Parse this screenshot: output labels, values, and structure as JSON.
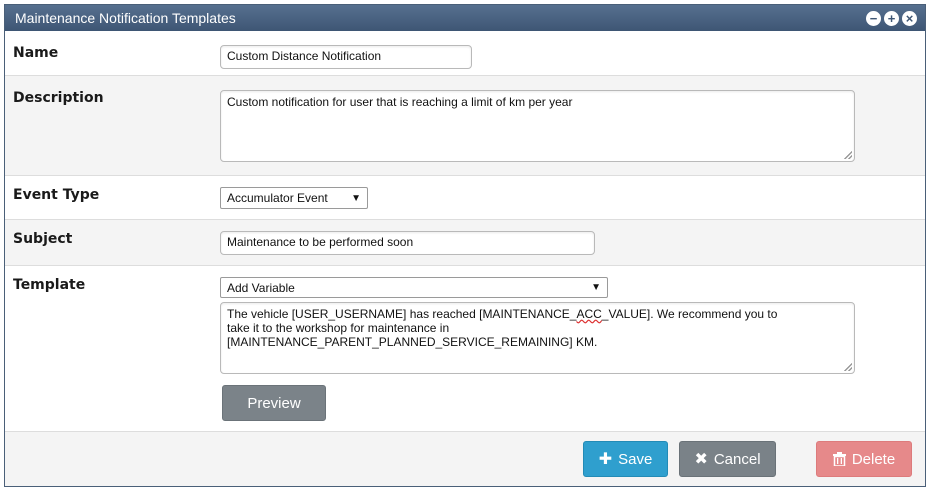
{
  "window": {
    "title": "Maintenance Notification Templates",
    "controls": {
      "minimize": "−",
      "maximize": "+",
      "close": "×"
    }
  },
  "form": {
    "name": {
      "label": "Name",
      "value": "Custom Distance Notification"
    },
    "description": {
      "label": "Description",
      "value": "Custom notification for user that is reaching a limit of km per year"
    },
    "event_type": {
      "label": "Event Type",
      "value": "Accumulator Event"
    },
    "subject": {
      "label": "Subject",
      "value": "Maintenance to be performed soon"
    },
    "template": {
      "label": "Template",
      "variable_select": "Add Variable",
      "body_line1_a": "The vehicle [USER_USERNAME] has reached [MAINTENANCE_",
      "body_line1_b": "ACC",
      "body_line1_c": "_VALUE]. We recommend you to",
      "body_line2": "take it to the workshop for maintenance in",
      "body_line3": "[MAINTENANCE_PARENT_PLANNED_SERVICE_REMAINING] KM."
    },
    "preview_label": "Preview"
  },
  "footer": {
    "save_label": "Save",
    "cancel_label": "Cancel",
    "delete_label": "Delete"
  },
  "icons": {
    "save": "plus-icon",
    "cancel": "x-icon",
    "delete": "trash-icon"
  }
}
